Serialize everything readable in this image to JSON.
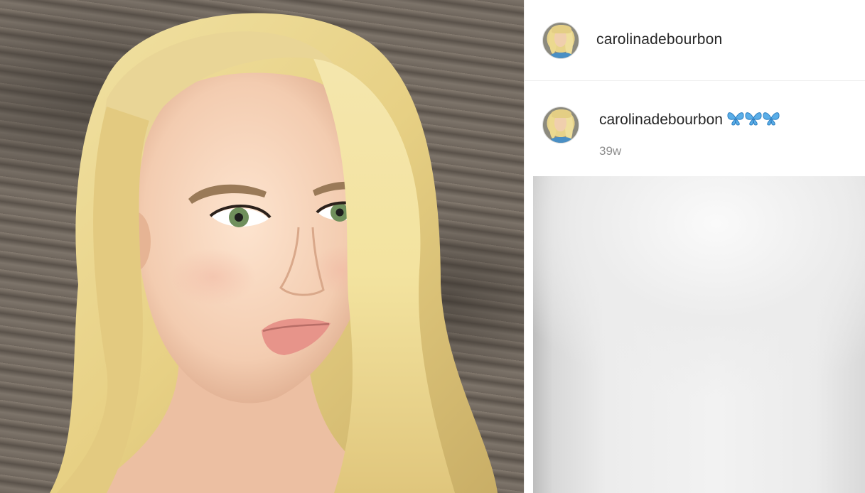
{
  "post": {
    "header": {
      "username": "carolinadebourbon",
      "avatar_icon": "profile-avatar"
    },
    "caption": {
      "username": "carolinadebourbon",
      "emoji": "🦋🦋🦋",
      "time_ago": "39w"
    },
    "photo_icon": "portrait-photo",
    "preview_icon": "blurred-image"
  },
  "colors": {
    "text_primary": "#262626",
    "text_secondary": "#8e8e8e",
    "divider": "#efefef",
    "butterfly": "#5aaee8"
  }
}
